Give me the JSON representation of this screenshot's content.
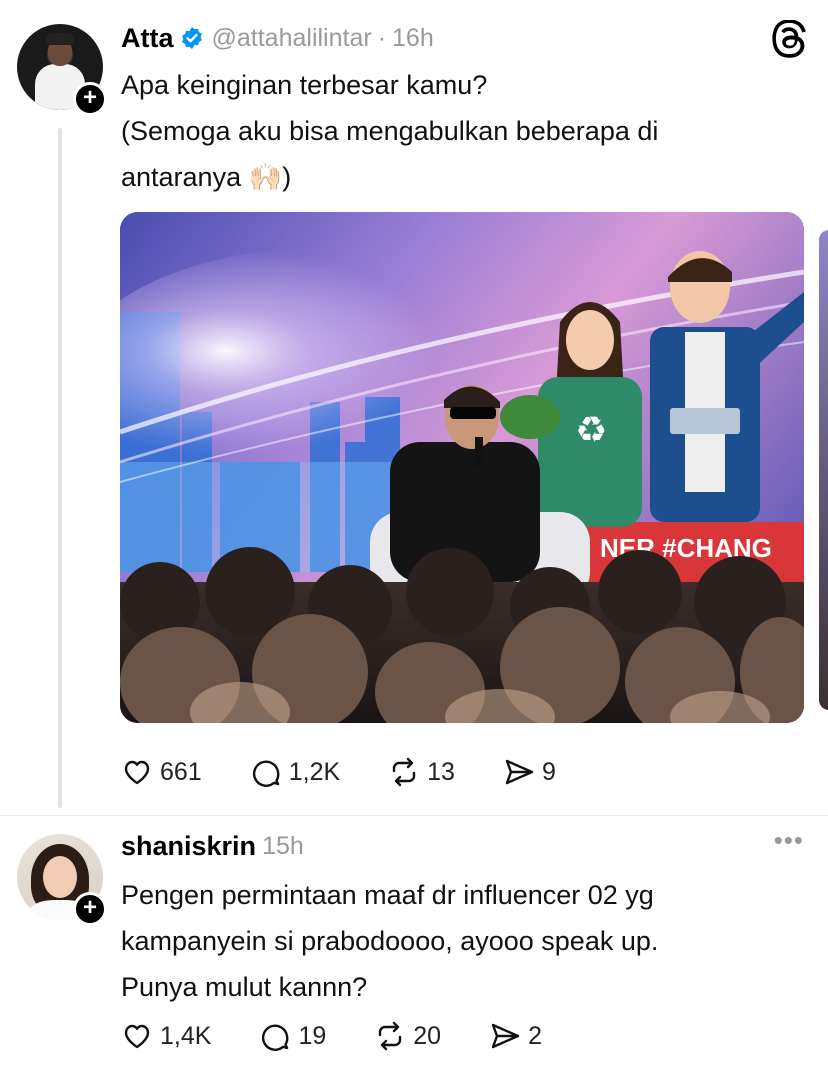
{
  "main_post": {
    "author": "Atta",
    "handle": "@attahalilintar",
    "separator": "·",
    "time": "16h",
    "text_lines": [
      "Apa keinginan terbesar kamu?",
      "(Semoga aku bisa mengabulkan beberapa di",
      "antaranya 🙌🏻)"
    ],
    "image_overlay_text": "NER #CHANG",
    "actions": {
      "likes": "661",
      "comments": "1,2K",
      "reposts": "13",
      "shares": "9"
    }
  },
  "reply_post": {
    "author": "shaniskrin",
    "time": "15h",
    "text_lines": [
      "Pengen permintaan maaf dr influencer 02 yg",
      "kampanyein si prabodoooo, ayooo speak up.",
      "Punya mulut kannn?"
    ],
    "actions": {
      "likes": "1,4K",
      "comments": "19",
      "reposts": "20",
      "shares": "2"
    }
  },
  "follow_glyph": "+",
  "more_glyph": "•••",
  "colors": {
    "verified": "#0095f6",
    "text": "#111111",
    "muted": "#999999",
    "thread_line": "#e3e3e3"
  },
  "icons": [
    "heart-icon",
    "comment-icon",
    "repost-icon",
    "share-icon",
    "threads-logo-icon",
    "verified-icon",
    "more-icon"
  ]
}
